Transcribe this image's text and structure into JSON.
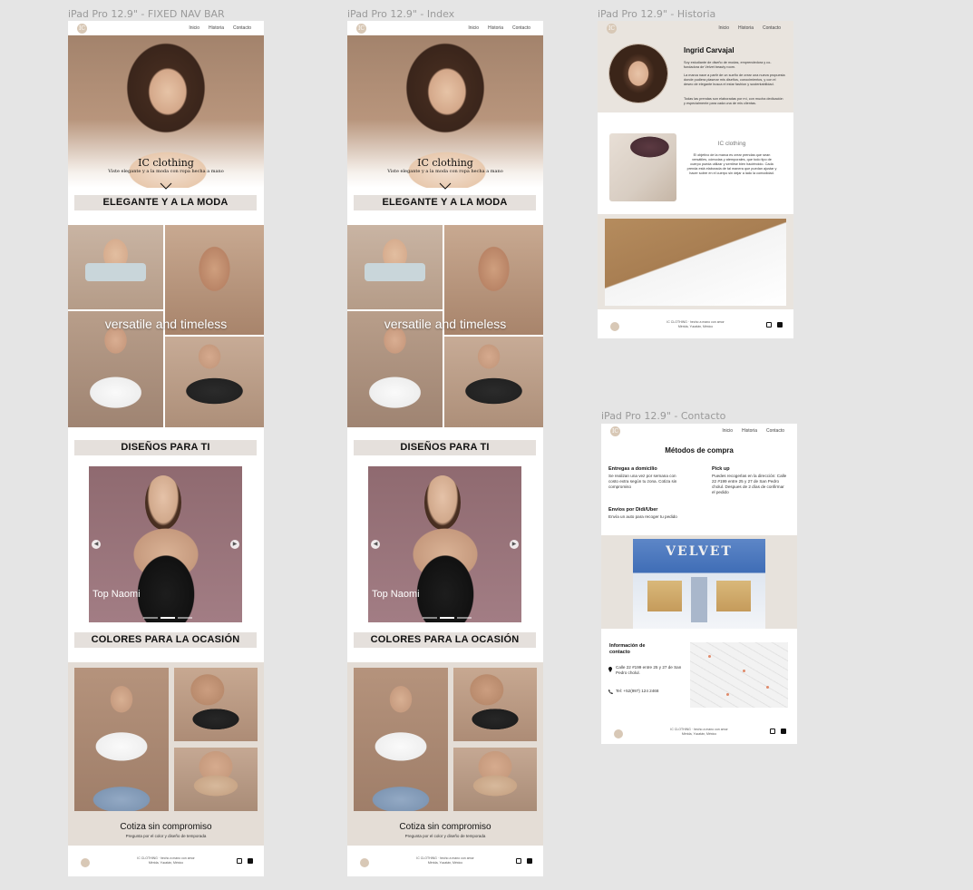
{
  "frames": {
    "fixed_nav": {
      "label": "iPad Pro 12.9\" - FIXED NAV BAR"
    },
    "index": {
      "label": "iPad Pro 12.9\" - Index"
    },
    "historia": {
      "label": "iPad Pro 12.9\" - Historia"
    },
    "contacto": {
      "label": "iPad Pro 12.9\" - Contacto"
    }
  },
  "nav": {
    "inicio": "Inicio",
    "historia": "Historia",
    "contacto": "Contacto",
    "logo": "IC"
  },
  "home": {
    "hero_title": "IC clothing",
    "hero_subtitle": "Viste elegante y a la moda con ropa hecha a mano",
    "band1": "ELEGANTE Y A LA MODA",
    "overlay": "versatile and timeless",
    "band2": "DISEÑOS PARA TI",
    "carousel_caption": "Top Naomi",
    "band3": "COLORES PARA LA OCASIÓN",
    "cta_title": "Cotiza sin compromiso",
    "cta_sub": "Pregunta por el color y diseño de temporada"
  },
  "footer": {
    "line1": "IC CLOTHING · hecho a mano con amor",
    "line2": "Mérida, Yucatán, México"
  },
  "historia": {
    "name": "Ingrid Carvajal",
    "p1": "Soy estudiante de diseño de modas, emprendedora y co-fundadora de Velvet beauty room.",
    "p2": "La marca nace a partir de un sueño de crear una nueva propuesta donde pudiera plasmar mis diseños, conocimientos, y con el deseo de elegante busca el estar fashion y sustentabilidad.",
    "p3": "Todas las prendas son elaboradas por mí, con mucha dedicación y especialmente para cada una de mis clientas.",
    "brand": "IC clothing",
    "objective": "El objetivo de la marca es crear prendas que sean versátiles, cómodas y atemporales, que todo tipo de cuerpo pueda utilizar y sentirse bien haciéndolo. Cada prenda está elaborada de tal manera que puedan ajustar y hacer sobre en el cuerpo sin dejar a lado la comodidad."
  },
  "contacto": {
    "title": "Métodos de compra",
    "domicilio_h": "Entregas a domicilio",
    "domicilio_t": "Se realizan una vez por semana con costo extra según tu zona. Cotiza sin compromiso",
    "pickup_h": "Pick up",
    "pickup_t": "Puedes recogerlas en la dirección: Calle 22 #199 entre 25 y 27 de San Pedro cholul. Despues de 2 días de confirmar el pedido",
    "didi_h": "Envíos por Didi/Uber",
    "didi_t": "Envía un auto para recoger tu pedido",
    "store_sign": "VELVET",
    "info_h": "Información de contacto",
    "address": "Calle 22 #199 entre 25 y 27 de San Pedro cholul.",
    "phone": "Tel: +52(997) 124 2468"
  },
  "colors": {
    "band": "#e5e0dc",
    "canvas": "#e5e5e5",
    "cta_bg": "#e4ddd6"
  }
}
